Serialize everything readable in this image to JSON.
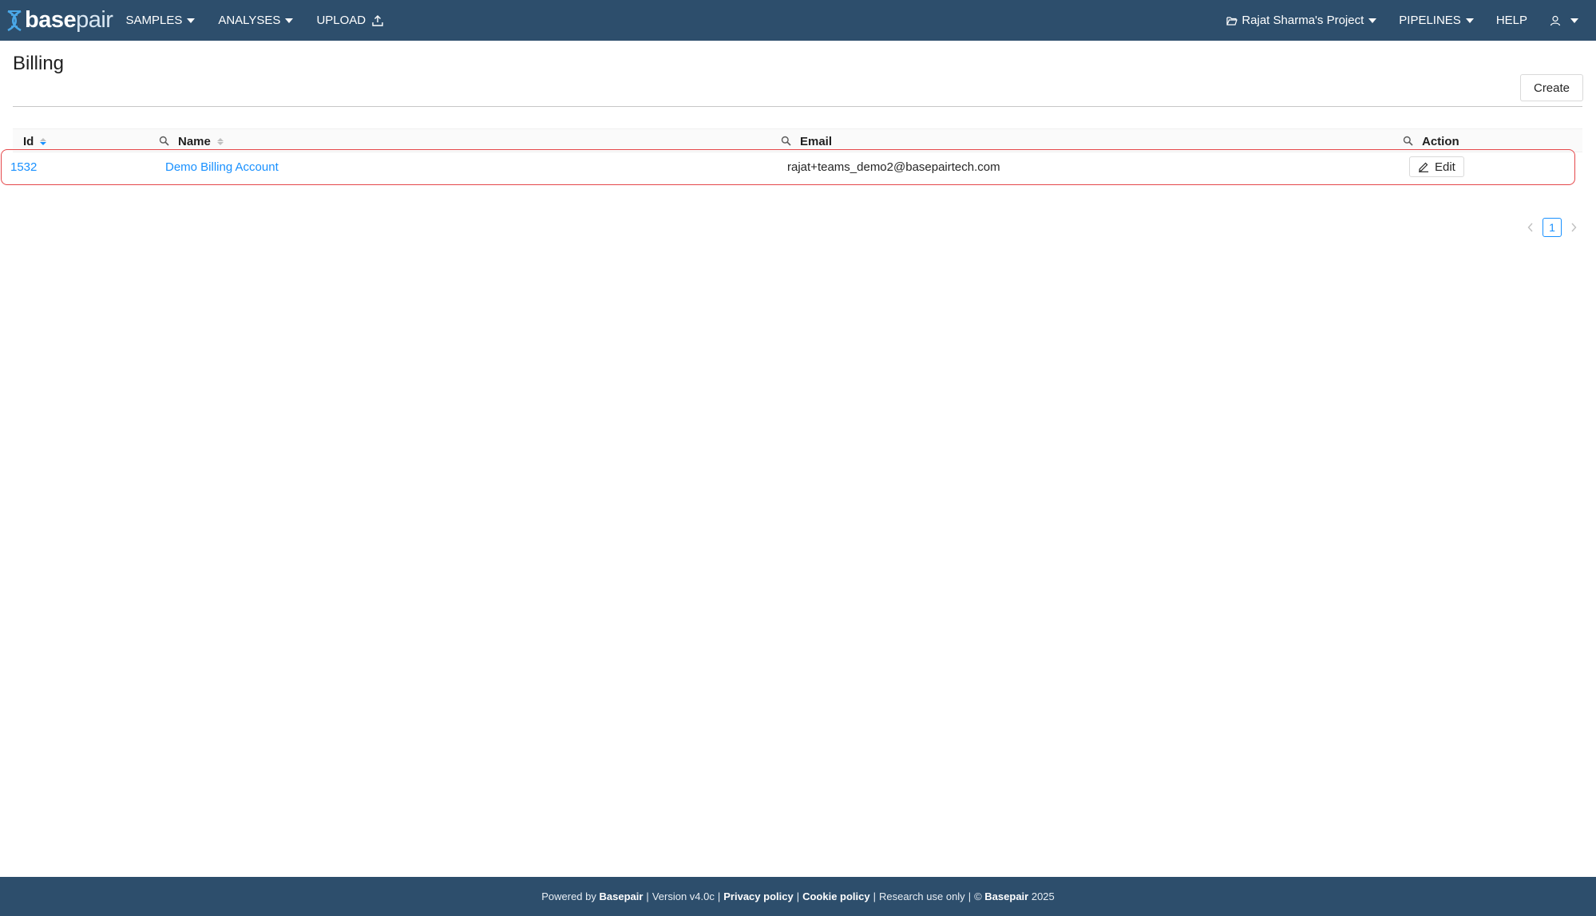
{
  "navbar": {
    "brand_bold": "base",
    "brand_light": "pair",
    "left_items": [
      {
        "label": "SAMPLES"
      },
      {
        "label": "ANALYSES"
      },
      {
        "label": "UPLOAD"
      }
    ],
    "project_label": "Rajat Sharma's Project",
    "pipelines_label": "PIPELINES",
    "help_label": "HELP"
  },
  "page": {
    "title": "Billing",
    "create_label": "Create"
  },
  "table": {
    "columns": [
      {
        "label": "Id",
        "sortable": true,
        "sort": "descending"
      },
      {
        "label": "Name",
        "sortable": true
      },
      {
        "label": "Email"
      },
      {
        "label": "Action"
      }
    ],
    "rows": [
      {
        "id": "1532",
        "name": "Demo Billing Account",
        "email": "rajat+teams_demo2@basepairtech.com",
        "action_label": "Edit"
      }
    ]
  },
  "pagination": {
    "current_page": "1"
  },
  "footer": {
    "powered_by": "Powered by",
    "brand": "Basepair",
    "version": "Version v4.0c",
    "privacy": "Privacy policy",
    "cookie": "Cookie policy",
    "research": "Research use only",
    "copyright_symbol": "©",
    "copyright_brand": "Basepair",
    "year": "2025"
  },
  "colors": {
    "navbar_bg": "#2d4e6c",
    "link": "#1890ff",
    "row_highlight_border": "#e5474a"
  }
}
